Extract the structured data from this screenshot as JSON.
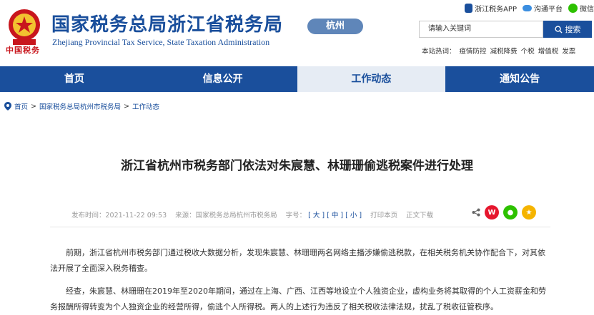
{
  "header": {
    "title_cn": "国家税务总局浙江省税务局",
    "title_en": "Zhejiang Provincial Tax Service, State Taxation Administration",
    "city": "杭州",
    "slogan": "中国税务"
  },
  "top_links": [
    {
      "label": "浙江税务APP"
    },
    {
      "label": "沟通平台"
    },
    {
      "label": "微信"
    }
  ],
  "search": {
    "placeholder": "请输入关键词",
    "button_label": "搜索"
  },
  "hotwords": {
    "label": "本站热词：",
    "items": [
      "疫情防控",
      "减税降费",
      "个税",
      "增值税",
      "发票"
    ]
  },
  "nav": [
    {
      "label": "首页"
    },
    {
      "label": "信息公开"
    },
    {
      "label": "工作动态"
    },
    {
      "label": "通知公告"
    }
  ],
  "breadcrumb": [
    "首页",
    "国家税务总局杭州市税务局",
    "工作动态"
  ],
  "article": {
    "title": "浙江省杭州市税务部门依法对朱宸慧、林珊珊偷逃税案件进行处理",
    "publish_time": "发布时间：2021-11-22  09:53",
    "source": "来源：国家税务总局杭州市税务局",
    "font_size_label": "字号：",
    "size_big": "[ 大 ]",
    "size_mid": "[ 中 ]",
    "size_small": "[ 小 ]",
    "print": "打印本页",
    "download": "正文下载",
    "paragraphs": [
      "前期，浙江省杭州市税务部门通过税收大数据分析，发现朱宸慧、林珊珊两名网络主播涉嫌偷逃税款，在相关税务机关协作配合下，对其依法开展了全面深入税务稽查。",
      "经查，朱宸慧、林珊珊在2019年至2020年期间，通过在上海、广西、江西等地设立个人独资企业，虚构业务将其取得的个人工资薪金和劳务报酬所得转变为个人独资企业的经营所得，偷逃个人所得税。两人的上述行为违反了相关税收法律法规，扰乱了税收征管秩序。"
    ]
  },
  "colors": {
    "brand_blue": "#1a4f9c",
    "badge_blue": "#5f86b9",
    "weibo_red": "#e6162d",
    "wechat_green": "#2dc100",
    "qzone_yellow": "#f5b400"
  }
}
